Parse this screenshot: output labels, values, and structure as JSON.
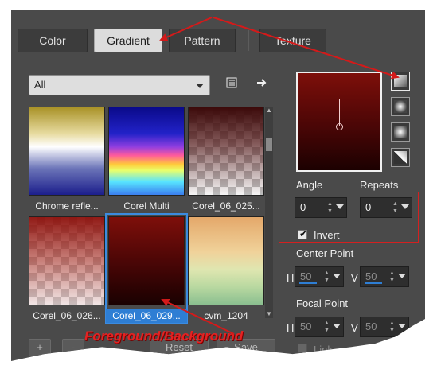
{
  "tabs": [
    {
      "label": "Color",
      "active": false
    },
    {
      "label": "Gradient",
      "active": true
    },
    {
      "label": "Pattern",
      "active": false
    },
    {
      "label": "Texture",
      "active": false
    }
  ],
  "category": {
    "selected": "All"
  },
  "toolbar_icons": [
    "gradient-list-icon",
    "export-arrow-icon"
  ],
  "gradients": [
    {
      "name": "Chrome refle...",
      "selected": false
    },
    {
      "name": "Corel Multi",
      "selected": false
    },
    {
      "name": "Corel_06_025...",
      "selected": false
    },
    {
      "name": "Corel_06_026...",
      "selected": false
    },
    {
      "name": "Corel_06_029...",
      "selected": true
    },
    {
      "name": "cvm_1204",
      "selected": false
    }
  ],
  "bottom_buttons": {
    "add": "+",
    "remove": "-",
    "reset": "Reset",
    "save": "Save"
  },
  "settings": {
    "angle_label": "Angle",
    "angle_value": "0",
    "repeats_label": "Repeats",
    "repeats_value": "0",
    "invert_label": "Invert",
    "invert_checked": true,
    "center_point_label": "Center Point",
    "center_h_label": "H",
    "center_h_value": "50",
    "center_v_label": "V",
    "center_v_value": "50",
    "focal_point_label": "Focal Point",
    "focal_h_label": "H",
    "focal_h_value": "50",
    "focal_v_label": "V",
    "focal_v_value": "50",
    "link_label": "Link"
  },
  "style_buttons": [
    "linear-style-icon",
    "rectangular-style-icon",
    "sunburst-style-icon",
    "radial-style-icon"
  ],
  "annotation": {
    "text": "Foreground/Background",
    "color": "#e52222"
  },
  "colors": {
    "accent": "#2e7ed4",
    "panel": "#4a4a4a",
    "highlight": "#d42020"
  }
}
